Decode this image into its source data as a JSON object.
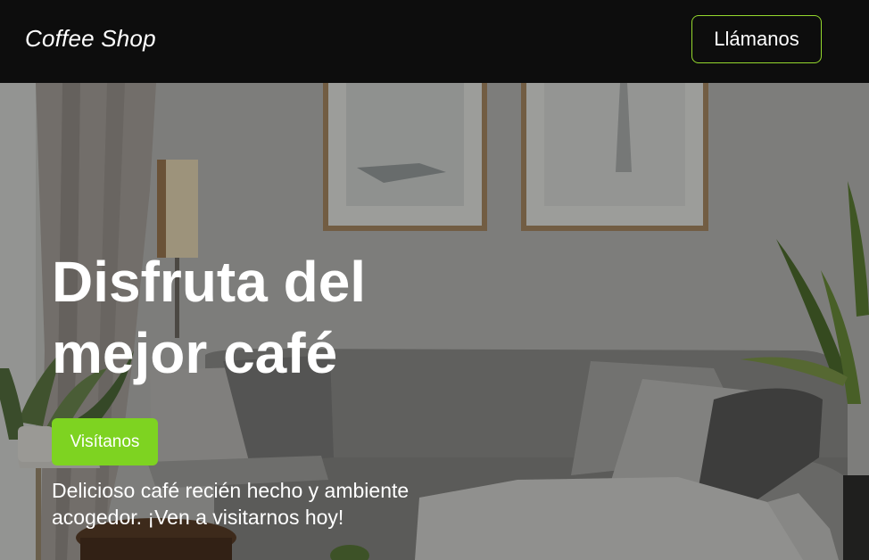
{
  "header": {
    "brand": "Coffee Shop",
    "call_button": "Llámanos"
  },
  "hero": {
    "title": "Disfruta del mejor café",
    "visit_button": "Visítanos",
    "description": "Delicioso café recién hecho y ambiente acogedor. ¡Ven a visitarnos hoy!",
    "background": "living-room-photo"
  },
  "colors": {
    "header_bg": "#0d0d0d",
    "accent": "#7ed321",
    "call_button_border": "#94d82d",
    "text": "#ffffff"
  }
}
